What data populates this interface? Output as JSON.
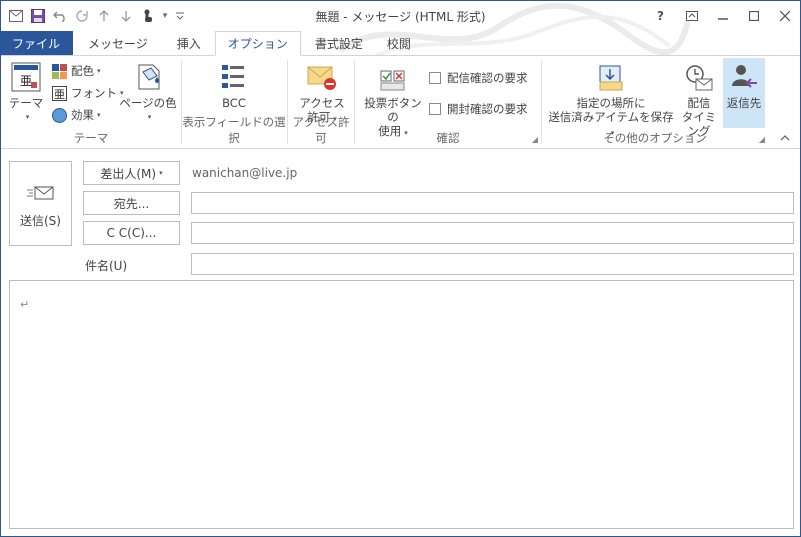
{
  "window": {
    "title": "無題 - メッセージ (HTML 形式)",
    "help": "?",
    "accent": "#2b579a"
  },
  "tabs": [
    {
      "label": "ファイル"
    },
    {
      "label": "メッセージ"
    },
    {
      "label": "挿入"
    },
    {
      "label": "オプション"
    },
    {
      "label": "書式設定"
    },
    {
      "label": "校閲"
    }
  ],
  "ribbon": {
    "theme_group": {
      "label": "テーマ",
      "theme": "テーマ",
      "colors": "配色",
      "fonts": "フォント",
      "effects": "効果",
      "page_color": "ページの色"
    },
    "fields_group": {
      "label": "表示フィールドの選択",
      "bcc": "BCC"
    },
    "permission_group": {
      "label": "アクセス許可",
      "permission_line1": "アクセス",
      "permission_line2": "許可"
    },
    "tracking_group": {
      "label": "確認",
      "vote_line1": "投票ボタンの",
      "vote_line2": "使用",
      "delivery_receipt": "配信確認の要求",
      "read_receipt": "開封確認の要求"
    },
    "more_group": {
      "label": "その他のオプション",
      "save_line1": "指定の場所に",
      "save_line2": "送信済みアイテムを保存",
      "delay_line1": "配信",
      "delay_line2": "タイミング",
      "reply_to": "返信先"
    }
  },
  "compose": {
    "send": "送信(S)",
    "from_button": "差出人(M)",
    "from_value": "wanichan@live.jp",
    "to_button": "宛先...",
    "cc_button": "C C(C)...",
    "subject_label": "件名(U)",
    "to_value": "",
    "cc_value": "",
    "subject_value": ""
  }
}
